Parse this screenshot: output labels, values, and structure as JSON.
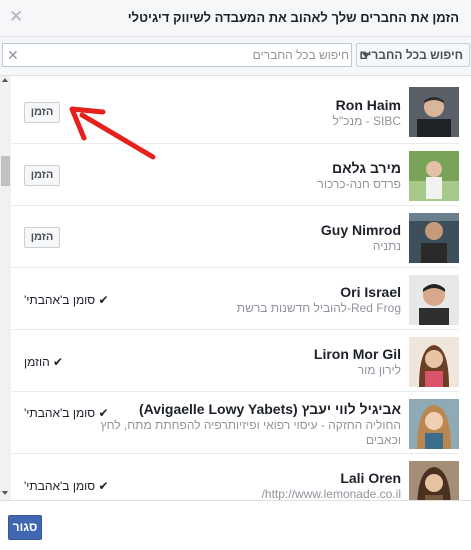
{
  "dialog": {
    "title": "הזמן את החברים שלך לאהוב את המעבדה לשיווק דיגיטלי",
    "close_glyph": "✕",
    "close_button_label": "סגור"
  },
  "toolbar": {
    "filter_label": "חיפוש בכל החברים",
    "search_placeholder": "חיפוש בכל החברים",
    "search_value": "",
    "clear_glyph": "✕"
  },
  "friends": [
    {
      "name": "Ron Haim",
      "subtitle": "SIBC - מנכ\"ל",
      "action": "invite",
      "action_label": "הזמן"
    },
    {
      "name": "מירב גלאם",
      "subtitle": "פרדס חנה-כרכור",
      "action": "invite",
      "action_label": "הזמן"
    },
    {
      "name": "Guy Nimrod",
      "subtitle": "נתניה",
      "action": "invite",
      "action_label": "הזמן"
    },
    {
      "name": "Ori Israel",
      "subtitle": "Red Frog-להוביל חדשנות ברשת",
      "action": "status",
      "action_label": "✔ סומן ב'אהבתי'"
    },
    {
      "name": "Liron Mor Gil",
      "subtitle": "לירון מור",
      "action": "status",
      "action_label": "✔ הוזמן"
    },
    {
      "name": "אביגיל לווי יעבץ (Avigaelle Lowy Yabets)",
      "subtitle": "החוליה החזקה - עיסוי רפואי ופיזיותרפיה להפחתת מתח, לחץ וכאבים",
      "action": "status",
      "action_label": "✔ סומן ב'אהבתי'"
    },
    {
      "name": "Lali Oren",
      "subtitle": "http://www.lemonade.co.il/",
      "action": "status",
      "action_label": "✔ סומן ב'אהבתי'"
    }
  ],
  "colors": {
    "primary_button": "#4267b2",
    "annotation_arrow": "#e8201b"
  }
}
